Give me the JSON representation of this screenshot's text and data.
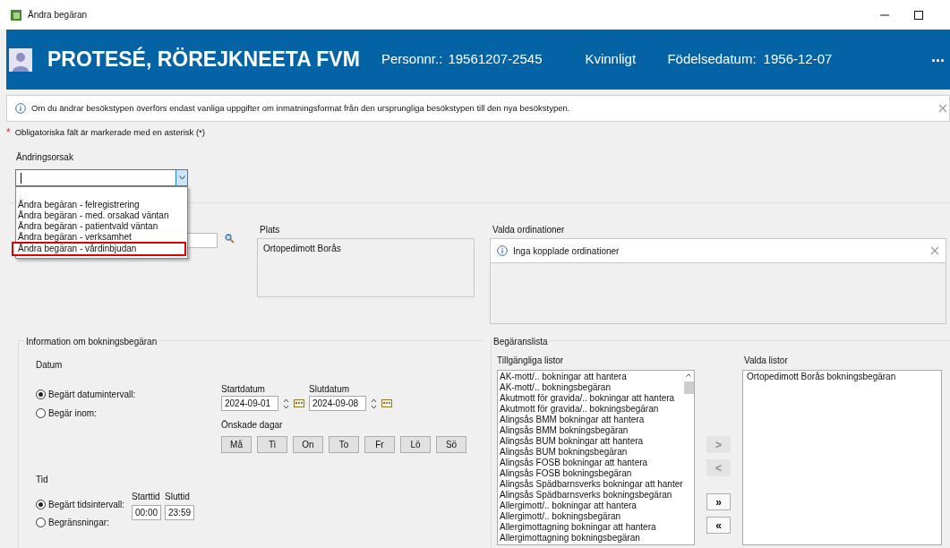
{
  "window": {
    "title": "Ändra begäran"
  },
  "patient": {
    "name": "PROTESÉ, RÖREJKNEETA FVM",
    "personnr_label": "Personnr.:",
    "personnr": "19561207-2545",
    "gender": "Kvinnligt",
    "birthdate_label": "Födelsedatum:",
    "birthdate": "1956-12-07",
    "more": "..."
  },
  "info_banner": {
    "text": "Om du ändrar besökstypen överförs endast vanliga uppgifter om inmatningsformat från den ursprungliga besökstypen till den nya besökstypen."
  },
  "required_note": {
    "mark": "*",
    "text": "Obligatoriska fält är markerade med en asterisk (*)"
  },
  "change_reason": {
    "label": "Ändringsorsak",
    "expanded": true,
    "options": [
      {
        "label": "Ändra begäran - felregistrering",
        "highlighted": false
      },
      {
        "label": "Ändra begäran - med. orsakad väntan",
        "highlighted": false
      },
      {
        "label": "Ändra begäran - patientvald väntan",
        "highlighted": false
      },
      {
        "label": "Ändra begäran - verksamhet",
        "highlighted": false
      },
      {
        "label": "Ändra begäran - vårdinbjudan",
        "highlighted": true
      }
    ]
  },
  "place": {
    "label": "Plats",
    "value": "Ortopedimott Borås"
  },
  "orders": {
    "label": "Valda ordinationer",
    "message": "Inga kopplade ordinationer"
  },
  "booking_info": {
    "title": "Information om bokningsbegäran",
    "date_heading": "Datum",
    "date_modes": [
      {
        "label": "Begärt datumintervall:",
        "selected": true
      },
      {
        "label": "Begär inom:",
        "selected": false
      }
    ],
    "start_label": "Startdatum",
    "start": "2024-09-01",
    "end_label": "Slutdatum",
    "end": "2024-09-08",
    "days_label": "Önskade dagar",
    "days": [
      "Må",
      "Ti",
      "On",
      "To",
      "Fr",
      "Lö",
      "Sö"
    ],
    "time_heading": "Tid",
    "time_modes": [
      {
        "label": "Begärt tidsintervall:",
        "selected": true
      },
      {
        "label": "Begränsningar:",
        "selected": false
      }
    ],
    "start_time_label": "Starttid",
    "start_time": "00:00",
    "end_time_label": "Sluttid",
    "end_time": "23:59"
  },
  "request_lists": {
    "title": "Begäranslista",
    "available_label": "Tillgängliga listor",
    "available": [
      "AK-mott/.. bokningar att hantera",
      "AK-mott/.. bokningsbegäran",
      "Akutmott för gravida/.. bokningar att hantera",
      "Akutmott för gravida/.. bokningsbegäran",
      "Alingsås BMM bokningar att hantera",
      "Alingsås BMM bokningsbegäran",
      "Alingsås BUM bokningar att hantera",
      "Alingsås BUM bokningsbegäran",
      "Alingsås FOSB bokningar att hantera",
      "Alingsås FOSB bokningsbegäran",
      "Alingsås Spädbarnsverks bokningar att hanter",
      "Alingsås Spädbarnsverks bokningsbegäran",
      "Allergimott/.. bokningar att hantera",
      "Allergimott/.. bokningsbegäran",
      "Allergimottagning bokningar att hantera",
      "Allergimottagning bokningsbegäran"
    ],
    "transfer_buttons": [
      {
        "label": ">",
        "disabled": true
      },
      {
        "label": "<",
        "disabled": true
      },
      {
        "label": "»",
        "disabled": false
      },
      {
        "label": "«",
        "disabled": false
      }
    ],
    "selected_label": "Valda listor",
    "selected": [
      "Ortopedimott Borås bokningsbegäran"
    ]
  }
}
